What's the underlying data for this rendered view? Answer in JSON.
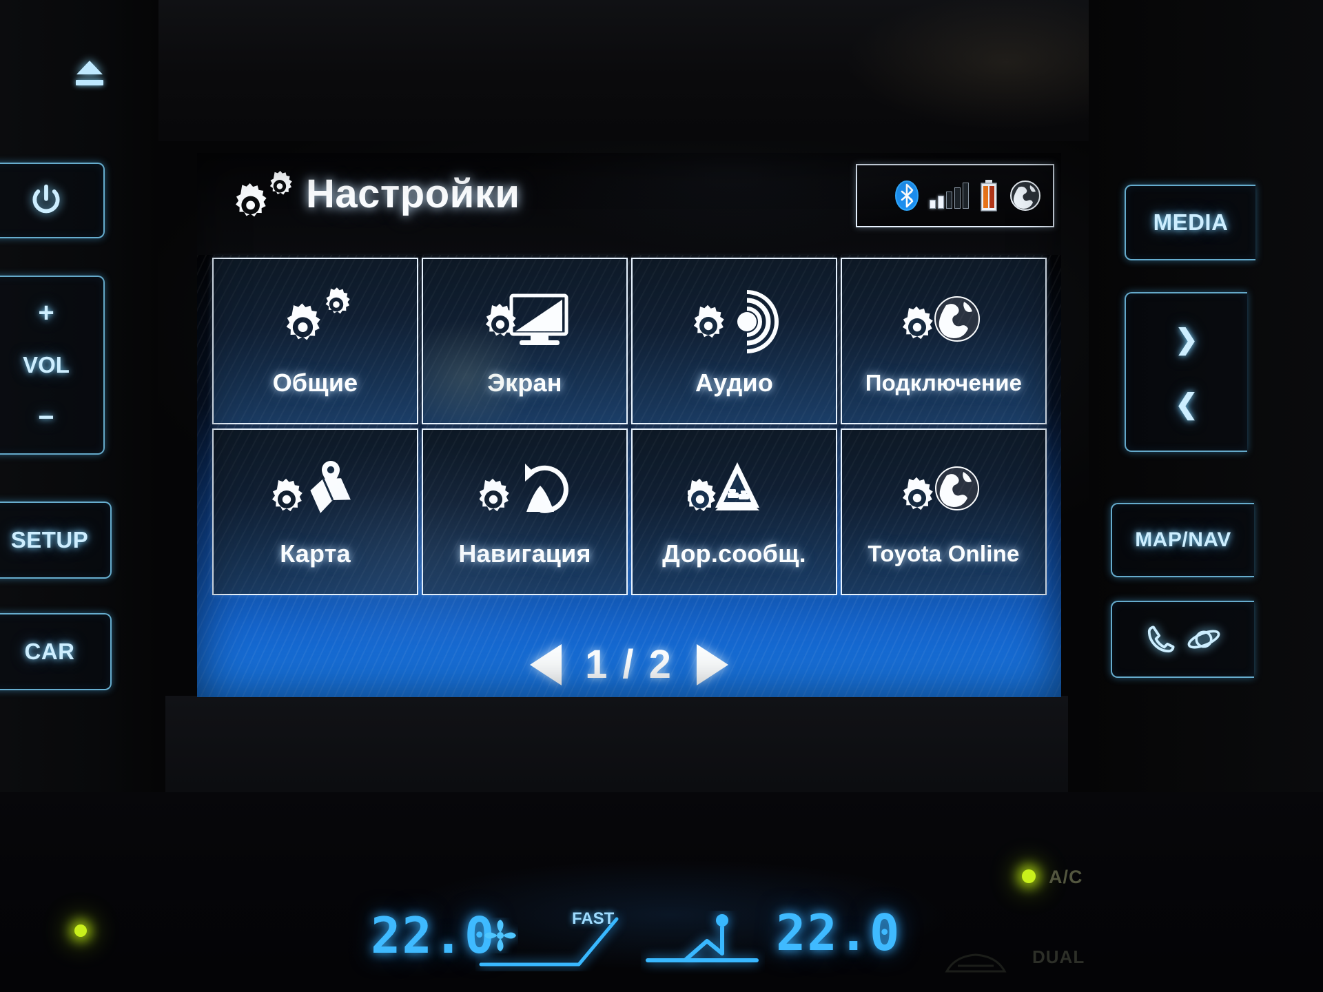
{
  "head_unit": {
    "screen": {
      "header": {
        "title": "Настройки",
        "gears_icon": "gears-icon"
      },
      "status_bar": {
        "bluetooth_icon": "bluetooth-icon",
        "signal_icon": "signal-bars-icon",
        "signal_bars_total": 5,
        "signal_bars_filled": 2,
        "battery_icon": "battery-icon",
        "globe_icon": "globe-icon"
      },
      "tiles": [
        {
          "label": "Общие",
          "icon": "gears-settings-icon"
        },
        {
          "label": "Экран",
          "icon": "gear-monitor-icon"
        },
        {
          "label": "Аудио",
          "icon": "gear-speaker-icon"
        },
        {
          "label": "Подключение",
          "icon": "gear-globe-icon"
        },
        {
          "label": "Карта",
          "icon": "gear-map-pin-icon"
        },
        {
          "label": "Навигация",
          "icon": "gear-route-icon"
        },
        {
          "label": "Дор.сообщ.",
          "icon": "gear-traffic-warning-icon"
        },
        {
          "label": "Toyota Online",
          "icon": "gear-globe-icon"
        }
      ],
      "pagination": {
        "prev_icon": "triangle-left-icon",
        "next_icon": "triangle-right-icon",
        "indicator": "1 / 2",
        "current_page": 1,
        "total_pages": 2
      }
    },
    "left_buttons": {
      "eject": {
        "icon": "eject-icon"
      },
      "power": {
        "icon": "power-icon"
      },
      "volume": {
        "plus": "+",
        "label": "VOL",
        "minus": "−"
      },
      "setup": "SETUP",
      "car": "CAR"
    },
    "right_buttons": {
      "media": "MEDIA",
      "seek": {
        "next": "❯",
        "prev": "❮"
      },
      "map_nav": "MAP/NAV",
      "phone": {
        "phone_icon": "phone-icon",
        "apps_icon": "globe-orbit-icon"
      }
    }
  },
  "climate": {
    "temp_left": "22.0",
    "fan_icon": "fan-icon",
    "fan_speed_label": "FAST",
    "airflow_icon": "airflow-seat-icon",
    "temp_right": "22.0",
    "ac_label": "A/C",
    "ac_led_on": true,
    "dual_label": "DUAL",
    "defrost_icon": "rear-defrost-icon"
  },
  "colors": {
    "backlight": "#80d6ff",
    "hvac_digits": "#3fbaff",
    "led_green": "#c9f01c",
    "bluetooth_blue": "#1c8ff0",
    "tile_border": "#e9f4ff",
    "grid_blue": "#1978e4"
  }
}
